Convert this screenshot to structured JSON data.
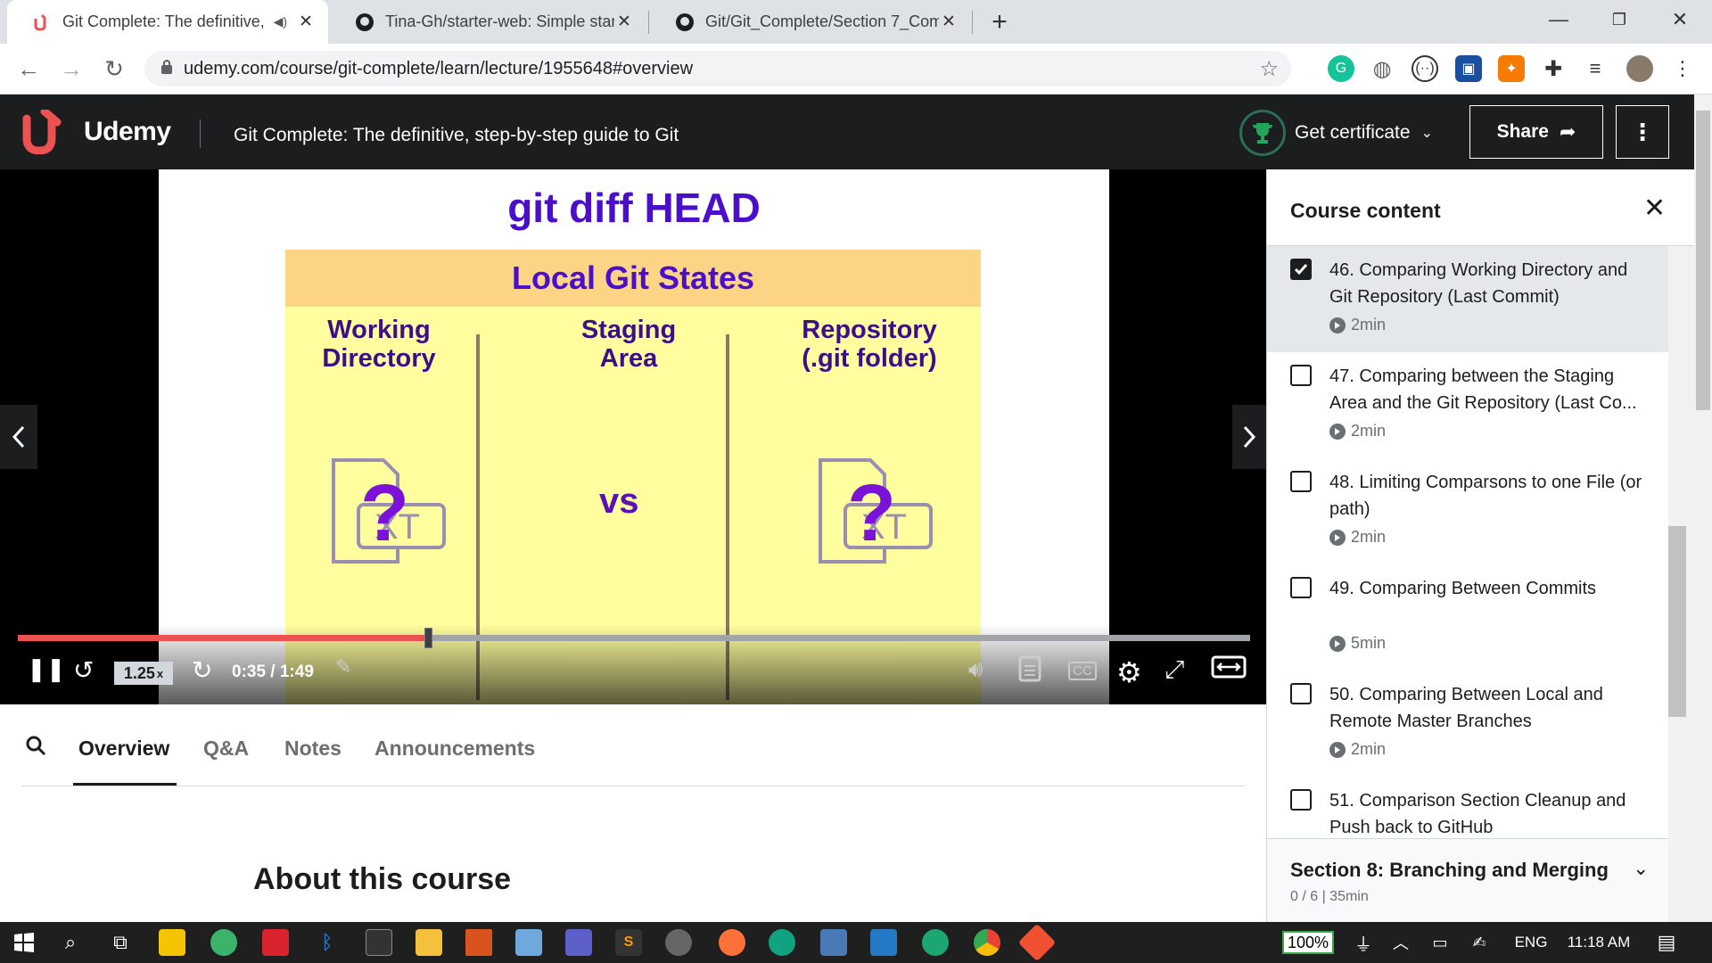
{
  "browser": {
    "tabs": [
      {
        "title": "Git Complete: The definitive,",
        "active": true
      },
      {
        "title": "Tina-Gh/starter-web: Simple star",
        "active": false
      },
      {
        "title": "Git/Git_Complete/Section 7_Com",
        "active": false
      }
    ],
    "url": "udemy.com/course/git-complete/learn/lecture/1955648#overview"
  },
  "header": {
    "logo_text": "Udemy",
    "course_title": "Git Complete: The definitive, step-by-step guide to Git",
    "certificate_label": "Get certificate",
    "share_label": "Share"
  },
  "slide": {
    "title": "git diff HEAD",
    "states_title": "Local Git States",
    "columns": [
      "Working\nDirectory",
      "Staging\nArea",
      "Repository\n(.git folder)"
    ],
    "vs": "vs",
    "file_mark": "?",
    "file_text": "XT"
  },
  "player": {
    "speed": "1.25",
    "speed_unit": "x",
    "time": "0:35 / 1:49",
    "progress": 0.33,
    "cc_label": "CC"
  },
  "content_tabs": [
    "Overview",
    "Q&A",
    "Notes",
    "Announcements"
  ],
  "about_heading": "About this course",
  "sidebar": {
    "title": "Course content",
    "lectures": [
      {
        "title": "46. Comparing Working Directory and Git Repository (Last Commit)",
        "duration": "2min",
        "done": true,
        "current": true
      },
      {
        "title": "47. Comparing between the Staging Area and the Git Repository (Last Co...",
        "duration": "2min",
        "done": false,
        "current": false
      },
      {
        "title": "48. Limiting Comparsons to one File (or path)",
        "duration": "2min",
        "done": false,
        "current": false
      },
      {
        "title": "49. Comparing Between Commits",
        "duration": "5min",
        "done": false,
        "current": false
      },
      {
        "title": "50. Comparing Between Local and Remote Master Branches",
        "duration": "2min",
        "done": false,
        "current": false
      },
      {
        "title": "51. Comparison Section Cleanup and Push back to GitHub",
        "duration": "2min",
        "done": false,
        "current": false
      }
    ],
    "next_section": {
      "title": "Section 8: Branching and Merging",
      "subtitle": "0 / 6 | 35min"
    }
  },
  "taskbar": {
    "zoom": "100%",
    "language": "ENG",
    "clock": "11:18 AM"
  },
  "colors": {
    "udemy_dark": "#1c1d1f",
    "progress_red": "#ec5252",
    "slide_purple": "#4b0fcc"
  }
}
